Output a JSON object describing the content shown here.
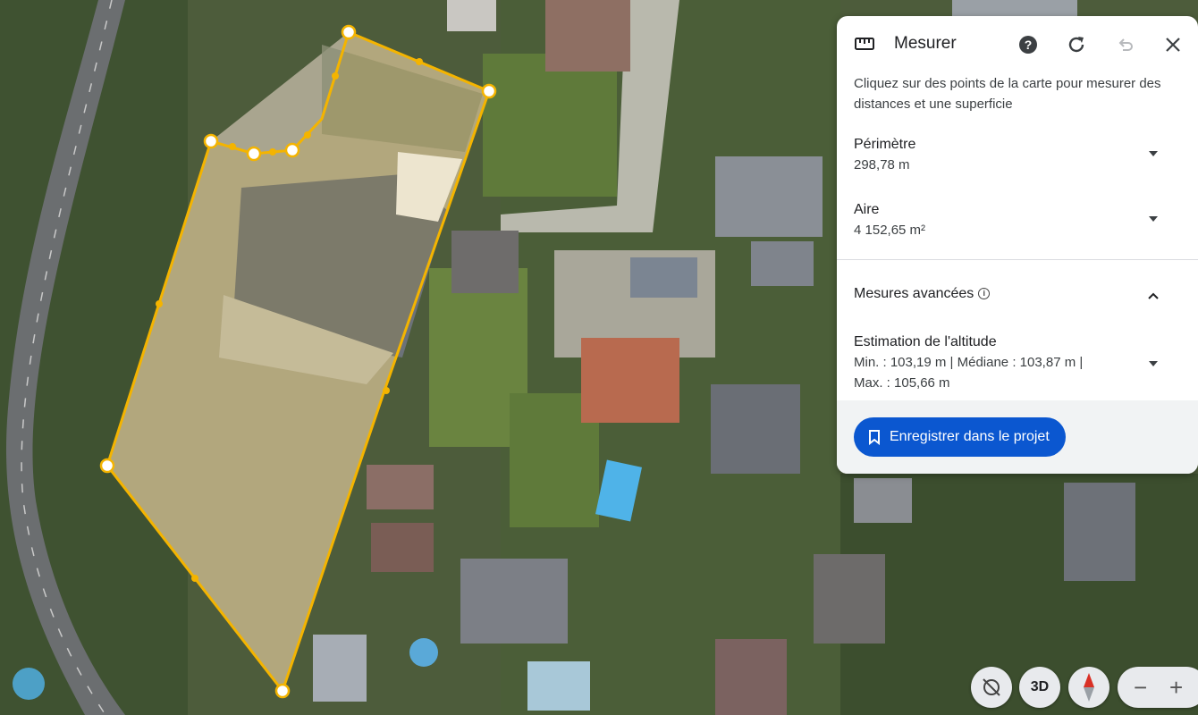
{
  "panel": {
    "title": "Mesurer",
    "icon": "ruler-icon",
    "description": "Cliquez sur des points de la carte pour mesurer des distances et une superficie",
    "perimeter": {
      "label": "Périmètre",
      "value": "298,78 m"
    },
    "area": {
      "label": "Aire",
      "value": "4 152,65 m²"
    },
    "advanced": {
      "label": "Mesures avancées"
    },
    "altitude": {
      "label": "Estimation de l'altitude",
      "line1": "Min. : 103,19 m | Médiane : 103,87 m |",
      "line2": "Max. : 105,66 m"
    },
    "save_label": "Enregistrer dans le projet",
    "accent": "#0b57d0"
  },
  "controls": {
    "three_d": "3D"
  },
  "measurement": {
    "line_color": "#f4b400"
  }
}
